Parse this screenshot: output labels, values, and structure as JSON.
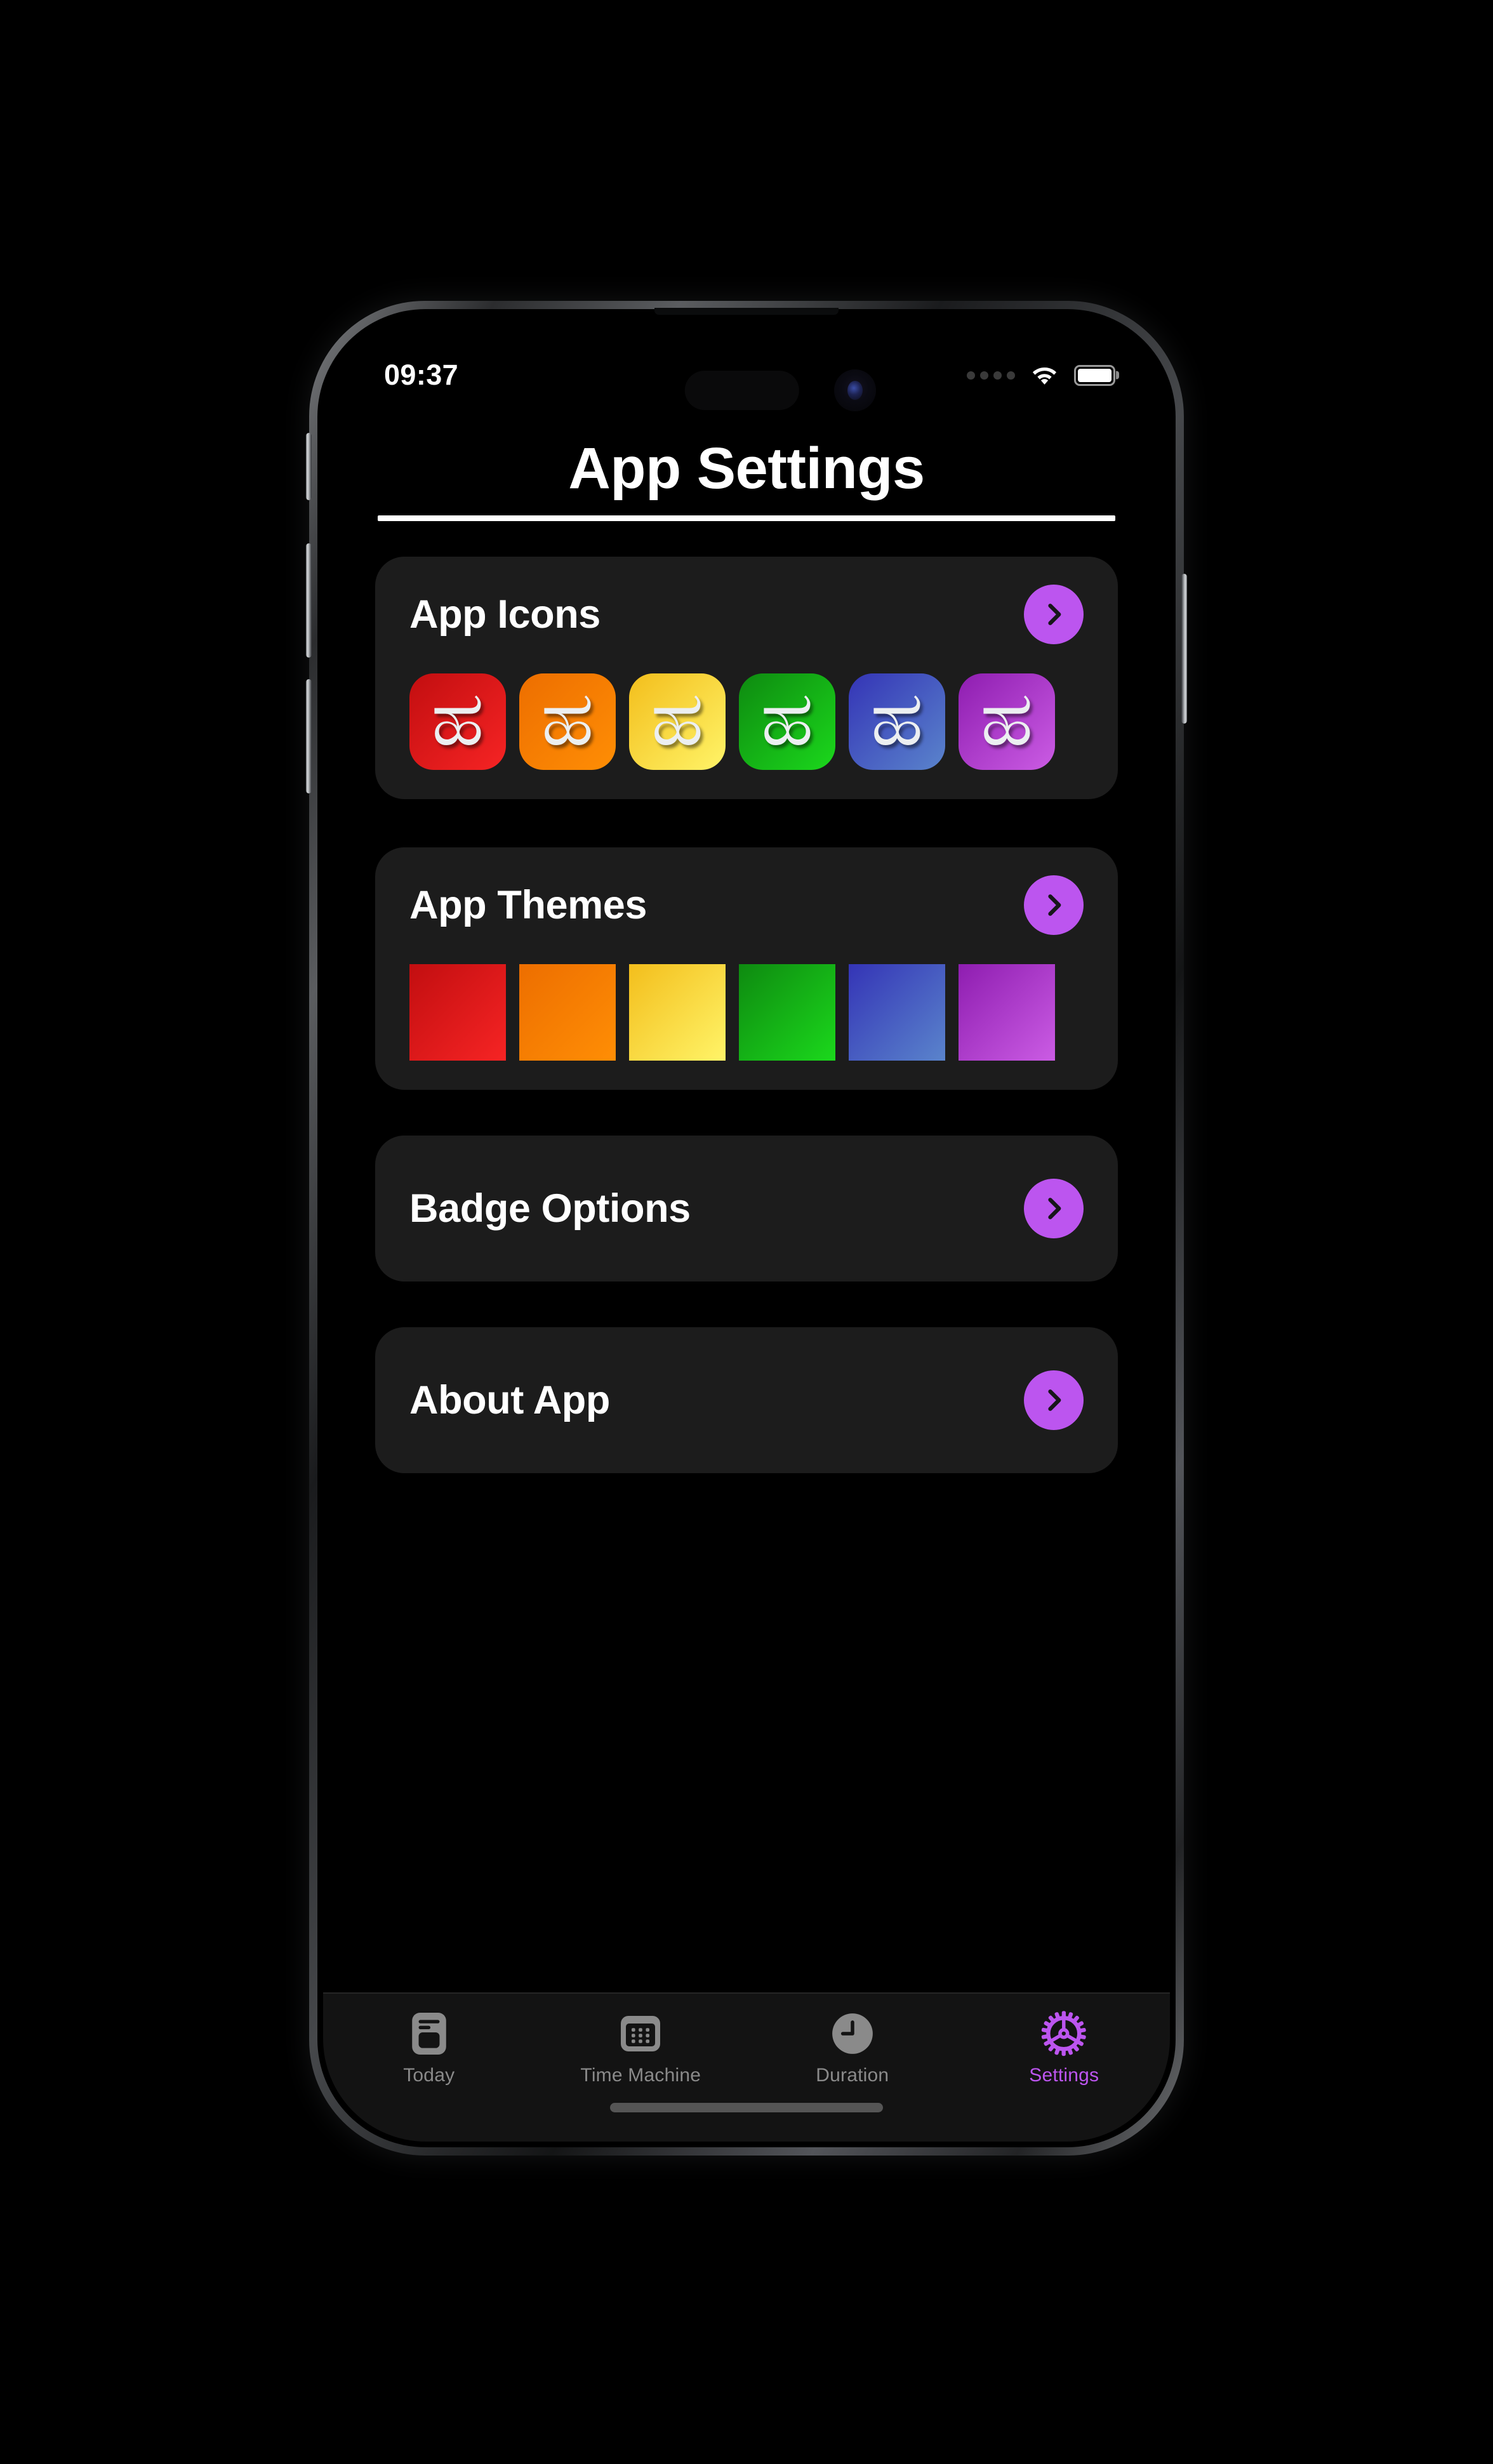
{
  "status_bar": {
    "time": "09:37",
    "cellular_icon": "cellular-dots-icon",
    "wifi_icon": "wifi-icon",
    "battery_icon": "battery-full-icon",
    "battery_level": "100"
  },
  "header": {
    "title": "App Settings"
  },
  "sections": [
    {
      "id": "app-icons",
      "title": "App Icons",
      "chevron_icon": "chevron-right-icon",
      "swatch_kind": "icon",
      "glyph": "ಹ",
      "swatches": [
        {
          "name": "red",
          "from": "#C20E10",
          "to": "#F62424"
        },
        {
          "name": "orange",
          "from": "#ED6E00",
          "to": "#FF8E05"
        },
        {
          "name": "yellow",
          "from": "#F3BE1C",
          "to": "#FFF468"
        },
        {
          "name": "green",
          "from": "#0E8A10",
          "to": "#1BD81C"
        },
        {
          "name": "blue",
          "from": "#3434B6",
          "to": "#5A84CC"
        },
        {
          "name": "purple",
          "from": "#8E1DB0",
          "to": "#CB5CE4"
        }
      ]
    },
    {
      "id": "app-themes",
      "title": "App Themes",
      "chevron_icon": "chevron-right-icon",
      "swatch_kind": "theme",
      "swatches": [
        {
          "name": "red",
          "from": "#C20E10",
          "to": "#F62424"
        },
        {
          "name": "orange",
          "from": "#ED6E00",
          "to": "#FF8E05"
        },
        {
          "name": "yellow",
          "from": "#F3BE1C",
          "to": "#FFF468"
        },
        {
          "name": "green",
          "from": "#0E8A10",
          "to": "#1BD81C"
        },
        {
          "name": "blue",
          "from": "#3434B6",
          "to": "#5A84CC"
        },
        {
          "name": "purple",
          "from": "#8E1DB0",
          "to": "#CB5CE4"
        }
      ]
    },
    {
      "id": "badge-options",
      "title": "Badge Options",
      "chevron_icon": "chevron-right-icon",
      "swatch_kind": "none",
      "swatches": []
    },
    {
      "id": "about-app",
      "title": "About App",
      "chevron_icon": "chevron-right-icon",
      "swatch_kind": "none",
      "swatches": []
    }
  ],
  "tabbar": {
    "items": [
      {
        "id": "today",
        "label": "Today",
        "icon": "document-note-icon",
        "active": false
      },
      {
        "id": "time-machine",
        "label": "Time Machine",
        "icon": "calendar-grid-icon",
        "active": false
      },
      {
        "id": "duration",
        "label": "Duration",
        "icon": "clock-icon",
        "active": false
      },
      {
        "id": "settings",
        "label": "Settings",
        "icon": "gear-icon",
        "active": true
      }
    ]
  },
  "theme": {
    "accent": "#BC55EF",
    "card_bg": "#1C1C1C",
    "screen_bg": "#000000",
    "tabbar_bg": "#131313",
    "inactive_tab": "#8A8A8A"
  }
}
